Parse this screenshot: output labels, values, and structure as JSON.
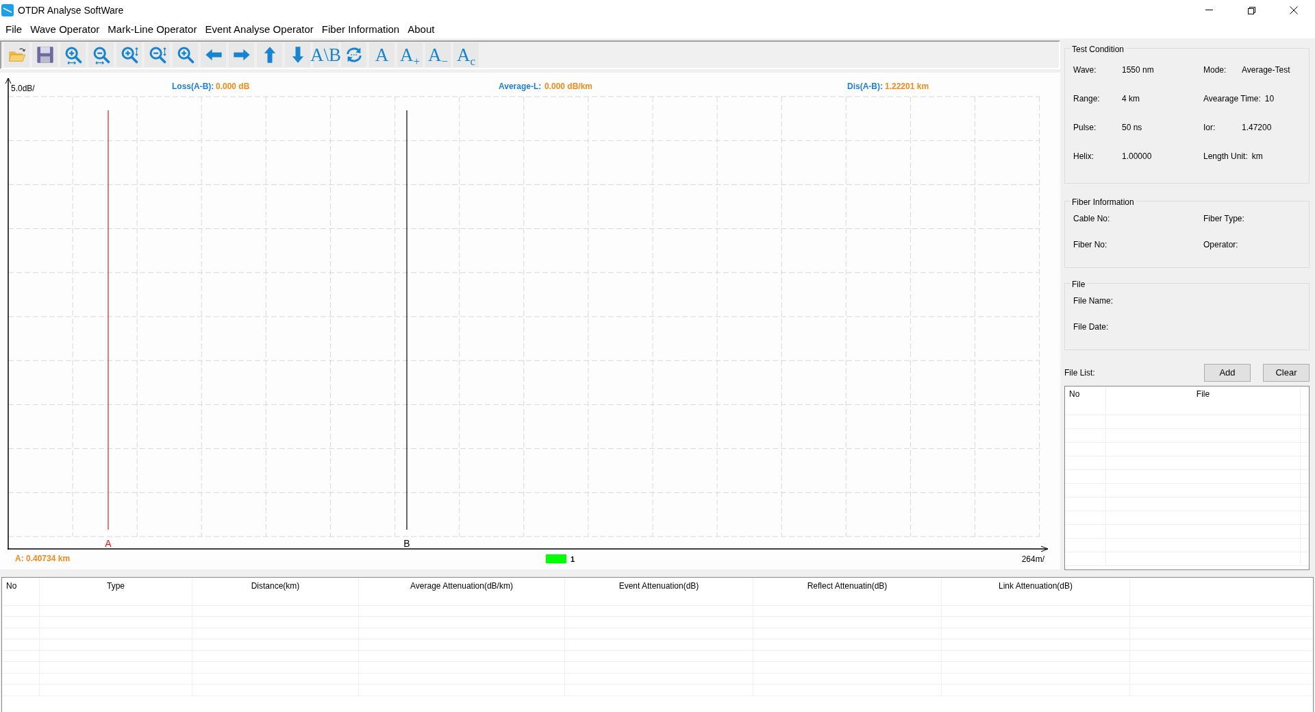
{
  "window": {
    "title": "OTDR Analyse SoftWare"
  },
  "menu": [
    "File",
    "Wave Operator",
    "Mark-Line Operator",
    "Event Analyse Operator",
    "Fiber Information",
    "About"
  ],
  "toolbar": [
    {
      "kind": "folder"
    },
    {
      "kind": "floppy"
    },
    {
      "kind": "zoom-in-h"
    },
    {
      "kind": "zoom-out-h"
    },
    {
      "kind": "zoom-in-v"
    },
    {
      "kind": "zoom-out-v"
    },
    {
      "kind": "zoom-in"
    },
    {
      "kind": "left"
    },
    {
      "kind": "right"
    },
    {
      "kind": "up"
    },
    {
      "kind": "down"
    },
    {
      "kind": "glyph",
      "glyph": "A\\B"
    },
    {
      "kind": "cycle"
    },
    {
      "kind": "glyph",
      "glyph": "A"
    },
    {
      "kind": "glyph",
      "glyph": "A$_{+}$"
    },
    {
      "kind": "glyph",
      "glyph": "A$_{−}$"
    },
    {
      "kind": "glyph",
      "glyph": "A$_{c}$"
    }
  ],
  "chart": {
    "scale_label": "5.0dB/",
    "readouts": [
      {
        "label": "Loss(A-B):",
        "value": "0.000 dB"
      },
      {
        "label": "Average-L:",
        "value": "0.000 dB/km"
      },
      {
        "label": "Dis(A-B):",
        "value": "1.22201 km"
      }
    ],
    "markers": [
      {
        "label": "A",
        "color": "#e02020"
      },
      {
        "label": "B",
        "color": "#000000"
      }
    ],
    "cursor_readout": "A: 0.40734 km",
    "legend": [
      {
        "label": "1",
        "color": "#00ff00"
      }
    ],
    "end_label": "264m/"
  },
  "test_condition": {
    "title": "Test Condition",
    "fields": [
      {
        "label": "Wave:",
        "value": "1550 nm"
      },
      {
        "label": "Mode:",
        "value": "Average-Test"
      },
      {
        "label": "Range:",
        "value": "4 km"
      },
      {
        "label": "Avearage Time:",
        "value": "10"
      },
      {
        "label": "Pulse:",
        "value": "50 ns"
      },
      {
        "label": "Ior:",
        "value": "1.47200"
      },
      {
        "label": "Helix:",
        "value": "1.00000"
      },
      {
        "label": "Length Unit:",
        "value": "km"
      }
    ]
  },
  "fiber_information": {
    "title": "Fiber Information",
    "fields": [
      "Cable No:",
      "Fiber Type:",
      "Fiber No:",
      "Operator:"
    ]
  },
  "file": {
    "title": "File",
    "fields": [
      "File Name:",
      "File Date:"
    ]
  },
  "file_list": {
    "label": "File List:",
    "buttons": [
      "Add",
      "Clear"
    ],
    "columns": [
      "No",
      "File"
    ]
  },
  "events_table": {
    "columns": [
      "No",
      "Type",
      "Distance(km)",
      "Average Attenuation(dB/km)",
      "Event Attenuation(dB)",
      "Reflect Attenuatin(dB)",
      "Link Attenuation(dB)"
    ]
  }
}
